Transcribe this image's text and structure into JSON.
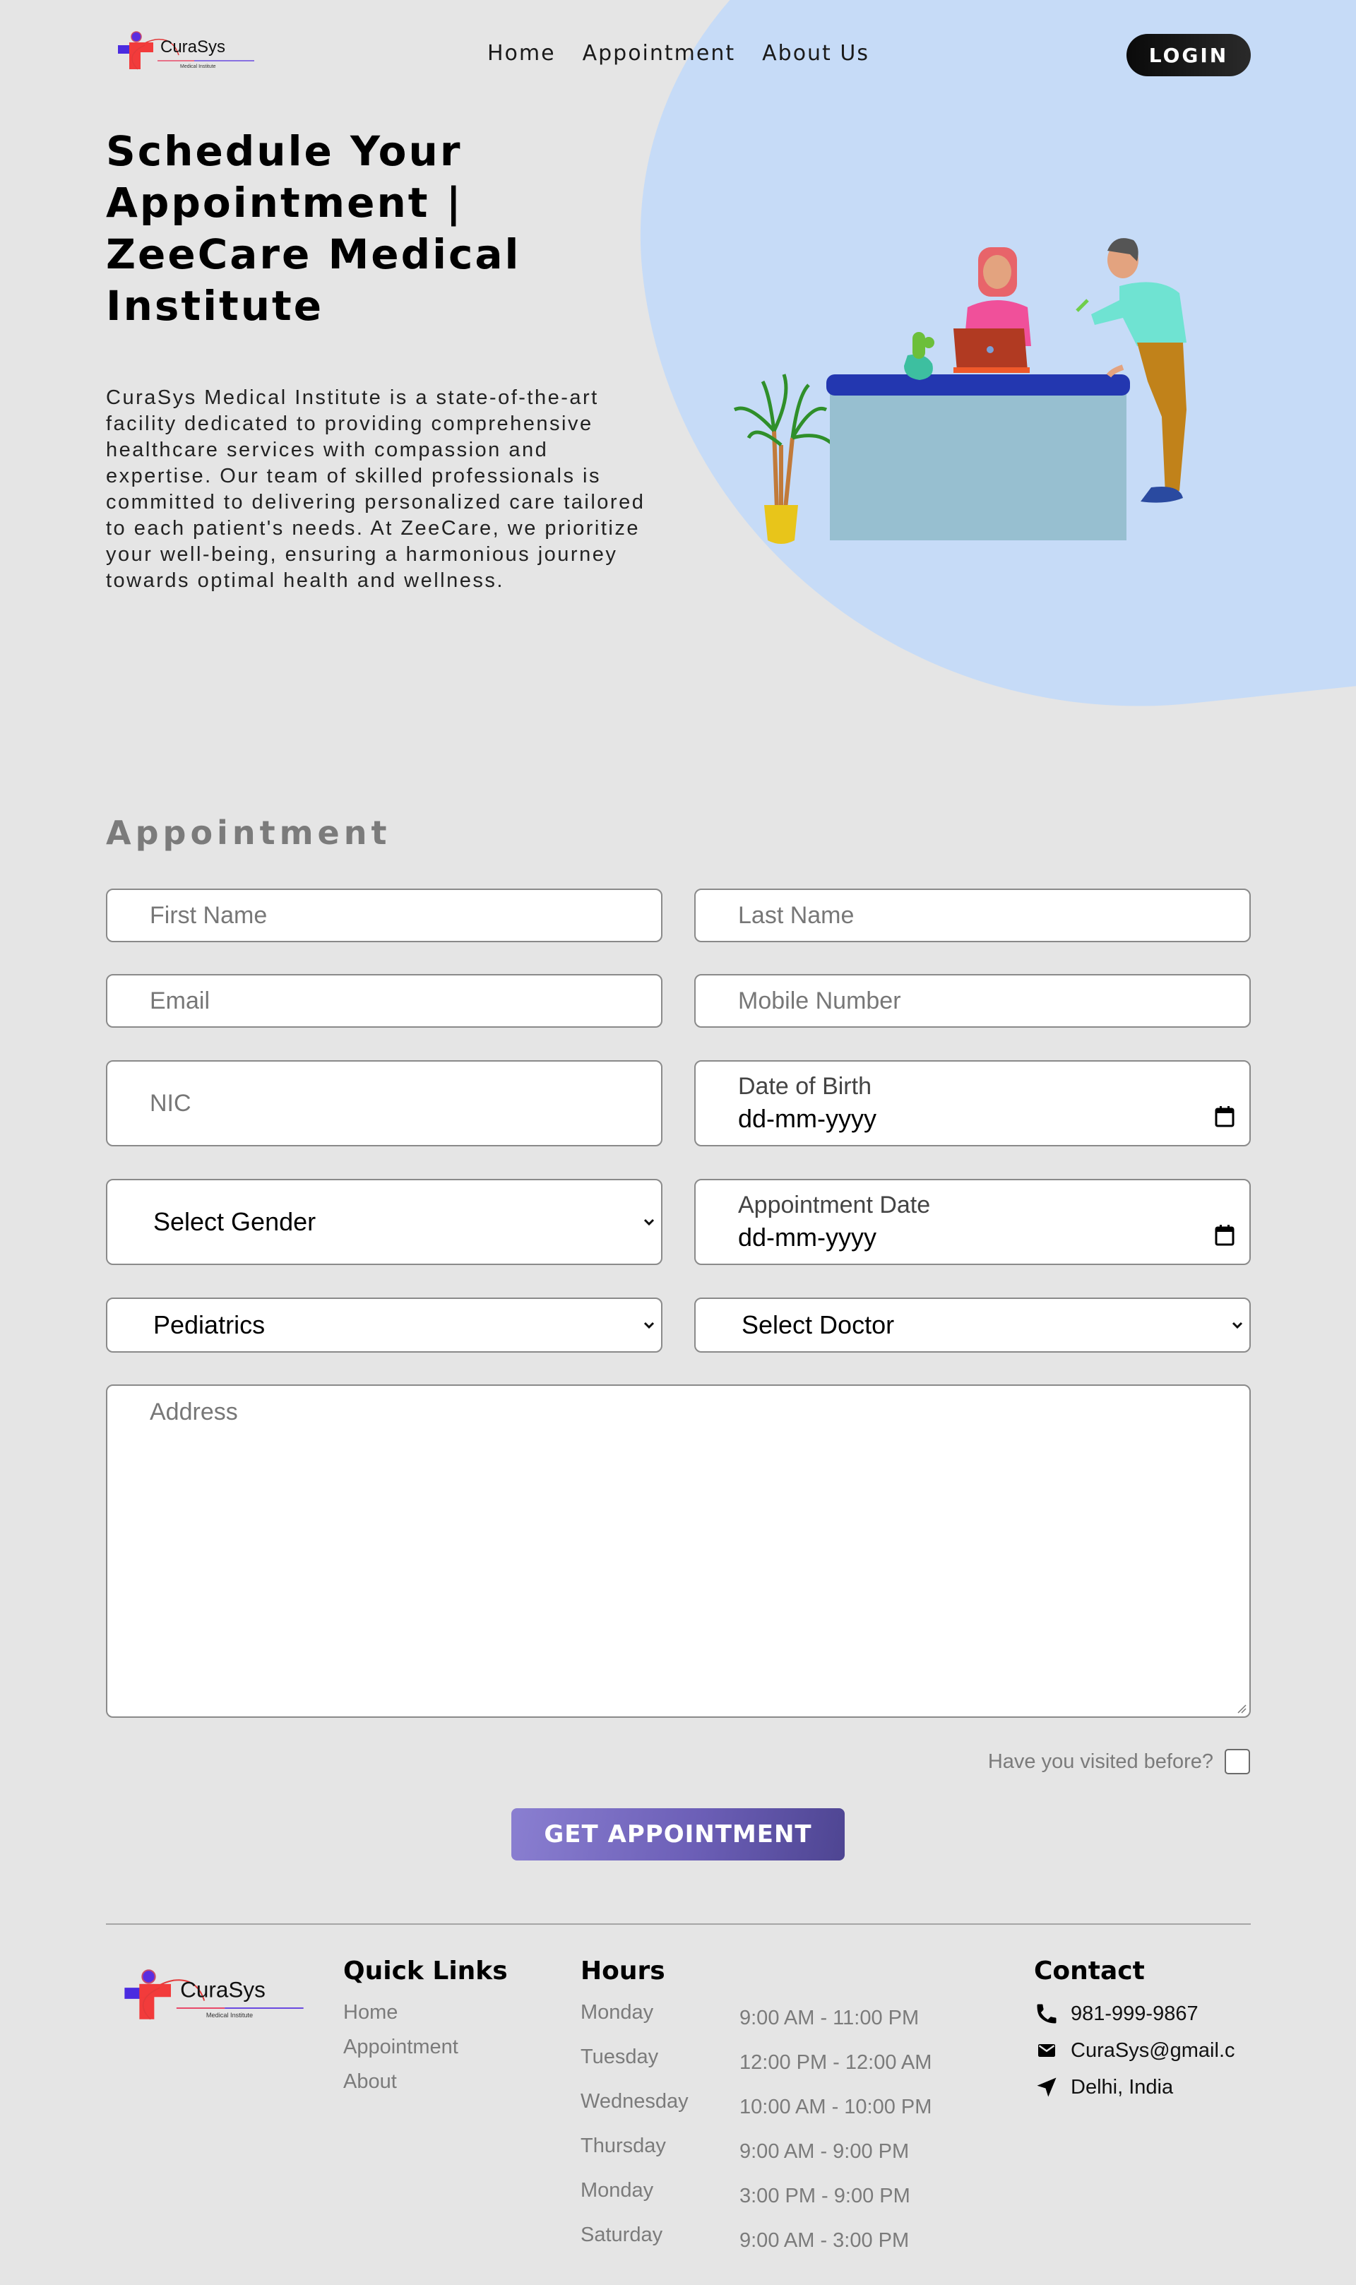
{
  "brand": {
    "name": "CuraSys",
    "tagline": "Medical Institute",
    "colors": {
      "blue": "#4a2be0",
      "red": "#f23b3b",
      "accent": "#6c5fb7",
      "hero_bg": "#c6dbf7"
    }
  },
  "nav": {
    "links": [
      {
        "label": "Home"
      },
      {
        "label": "Appointment"
      },
      {
        "label": "About Us"
      }
    ],
    "login_label": "LOGIN"
  },
  "hero": {
    "title": "Schedule Your Appointment | ZeeCare Medical Institute",
    "description": "CuraSys Medical Institute is a state-of-the-art facility dedicated to providing comprehensive healthcare services with compassion and expertise. Our team of skilled professionals is committed to delivering personalized care tailored to each patient's needs. At ZeeCare, we prioritize your well-being, ensuring a harmonious journey towards optimal health and wellness.",
    "illustration": "reception-desk-illustration"
  },
  "form": {
    "title": "Appointment",
    "first_name": {
      "placeholder": "First Name",
      "value": ""
    },
    "last_name": {
      "placeholder": "Last Name",
      "value": ""
    },
    "email": {
      "placeholder": "Email",
      "value": ""
    },
    "mobile": {
      "placeholder": "Mobile Number",
      "value": ""
    },
    "nic": {
      "placeholder": "NIC",
      "value": ""
    },
    "dob": {
      "label": "Date of Birth",
      "value": "dd-mm-yyyy"
    },
    "gender": {
      "selected": "Select Gender"
    },
    "appointment_date": {
      "label": "Appointment Date",
      "value": "dd-mm-yyyy"
    },
    "department": {
      "selected": "Pediatrics"
    },
    "doctor": {
      "selected": "Select Doctor"
    },
    "address": {
      "placeholder": "Address",
      "value": ""
    },
    "visited_label": "Have you visited before?",
    "visited_checked": false,
    "submit_label": "GET APPOINTMENT"
  },
  "footer": {
    "quick_links": {
      "heading": "Quick Links",
      "items": [
        {
          "label": "Home"
        },
        {
          "label": "Appointment"
        },
        {
          "label": "About"
        }
      ]
    },
    "hours": {
      "heading": "Hours",
      "rows": [
        {
          "day": "Monday",
          "time": "9:00 AM - 11:00 PM"
        },
        {
          "day": "Tuesday",
          "time": "12:00 PM - 12:00 AM"
        },
        {
          "day": "Wednesday",
          "time": "10:00 AM - 10:00 PM"
        },
        {
          "day": "Thursday",
          "time": "9:00 AM - 9:00 PM"
        },
        {
          "day": "Monday",
          "time": "3:00 PM - 9:00 PM"
        },
        {
          "day": "Saturday",
          "time": "9:00 AM - 3:00 PM"
        }
      ]
    },
    "contact": {
      "heading": "Contact",
      "phone": "981-999-9867",
      "email": "CuraSys@gmail.c",
      "location": "Delhi, India"
    }
  }
}
